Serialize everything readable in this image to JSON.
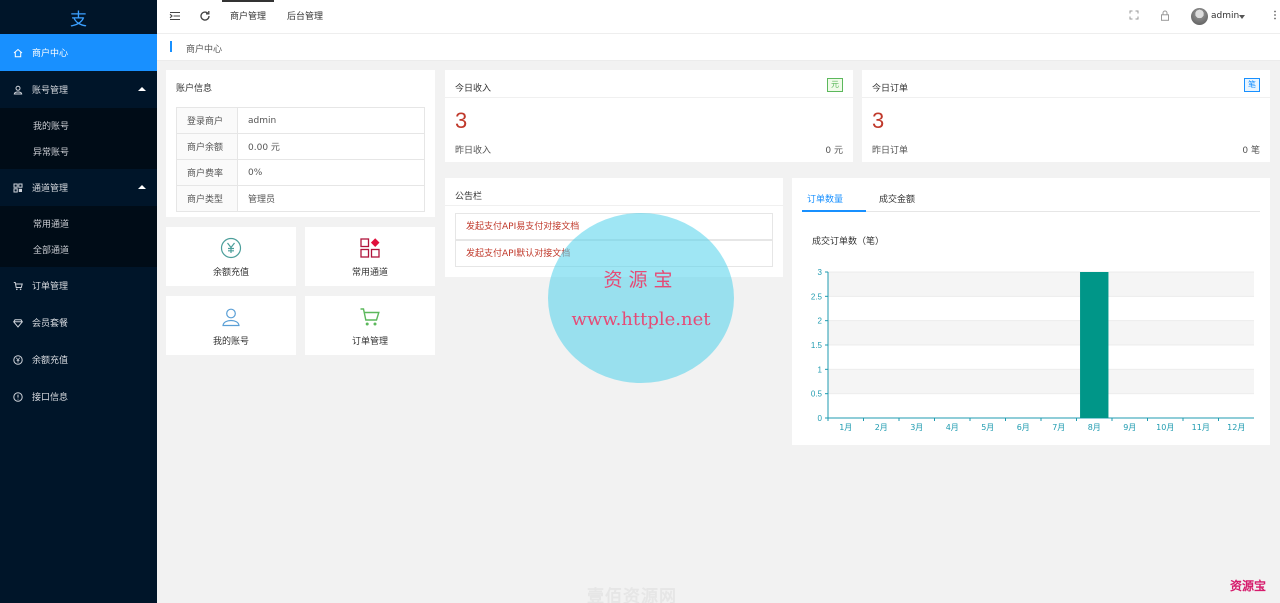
{
  "sidebar": {
    "logo": "支",
    "items": [
      {
        "label": "商户中心",
        "icon": "home-icon",
        "active": true
      },
      {
        "label": "账号管理",
        "icon": "user-icon",
        "expanded": true,
        "children": [
          "我的账号",
          "异常账号"
        ]
      },
      {
        "label": "通道管理",
        "icon": "channel-icon",
        "expanded": true,
        "children": [
          "常用通道",
          "全部通道"
        ]
      },
      {
        "label": "订单管理",
        "icon": "cart-icon"
      },
      {
        "label": "会员套餐",
        "icon": "diamond-icon"
      },
      {
        "label": "余额充值",
        "icon": "yen-circle-icon"
      },
      {
        "label": "接口信息",
        "icon": "info-circle-icon"
      }
    ]
  },
  "header": {
    "tabs": [
      "商户管理",
      "后台管理"
    ],
    "active_tab": 0,
    "user": "admin"
  },
  "breadcrumb": "商户中心",
  "account": {
    "title": "账户信息",
    "rows": [
      {
        "key": "登录商户",
        "value": "admin"
      },
      {
        "key": "商户余额",
        "value": "0.00 元"
      },
      {
        "key": "商户费率",
        "value": "0%"
      },
      {
        "key": "商户类型",
        "value": "管理员"
      }
    ]
  },
  "quick": [
    {
      "label": "余额充值",
      "icon": "yen-circle-icon"
    },
    {
      "label": "常用通道",
      "icon": "grid-icon"
    },
    {
      "label": "我的账号",
      "icon": "user-icon"
    },
    {
      "label": "订单管理",
      "icon": "cart-icon"
    }
  ],
  "income": {
    "title": "今日收入",
    "badge": "元",
    "value": "3",
    "yesterday_label": "昨日收入",
    "yesterday_value": "0 元"
  },
  "orders": {
    "title": "今日订单",
    "badge": "笔",
    "value": "3",
    "yesterday_label": "昨日订单",
    "yesterday_value": "0 笔"
  },
  "notice": {
    "title": "公告栏",
    "items": [
      "发起支付API易支付对接文档",
      "发起支付API默认对接文档"
    ]
  },
  "chart_tabs": [
    "订单数量",
    "成交金额"
  ],
  "chart_data": {
    "type": "bar",
    "title": "成交订单数（笔）",
    "categories": [
      "1月",
      "2月",
      "3月",
      "4月",
      "5月",
      "6月",
      "7月",
      "8月",
      "9月",
      "10月",
      "11月",
      "12月"
    ],
    "values": [
      0,
      0,
      0,
      0,
      0,
      0,
      0,
      3,
      0,
      0,
      0,
      0
    ],
    "ylim": [
      0,
      3
    ],
    "yticks": [
      "0",
      "0.5",
      "1",
      "1.5",
      "2",
      "2.5",
      "3"
    ],
    "color": "#009688",
    "axis_color": "#1f9bb0"
  },
  "watermark": {
    "line1": "资源宝",
    "line2": "www.httple.net"
  },
  "footer_watermark": "壹佰资源网",
  "corner_watermark": "资源宝",
  "colors": {
    "sidebar": "#001529",
    "active": "#1890ff",
    "accent_red": "#c0392b",
    "teal": "#009688"
  }
}
